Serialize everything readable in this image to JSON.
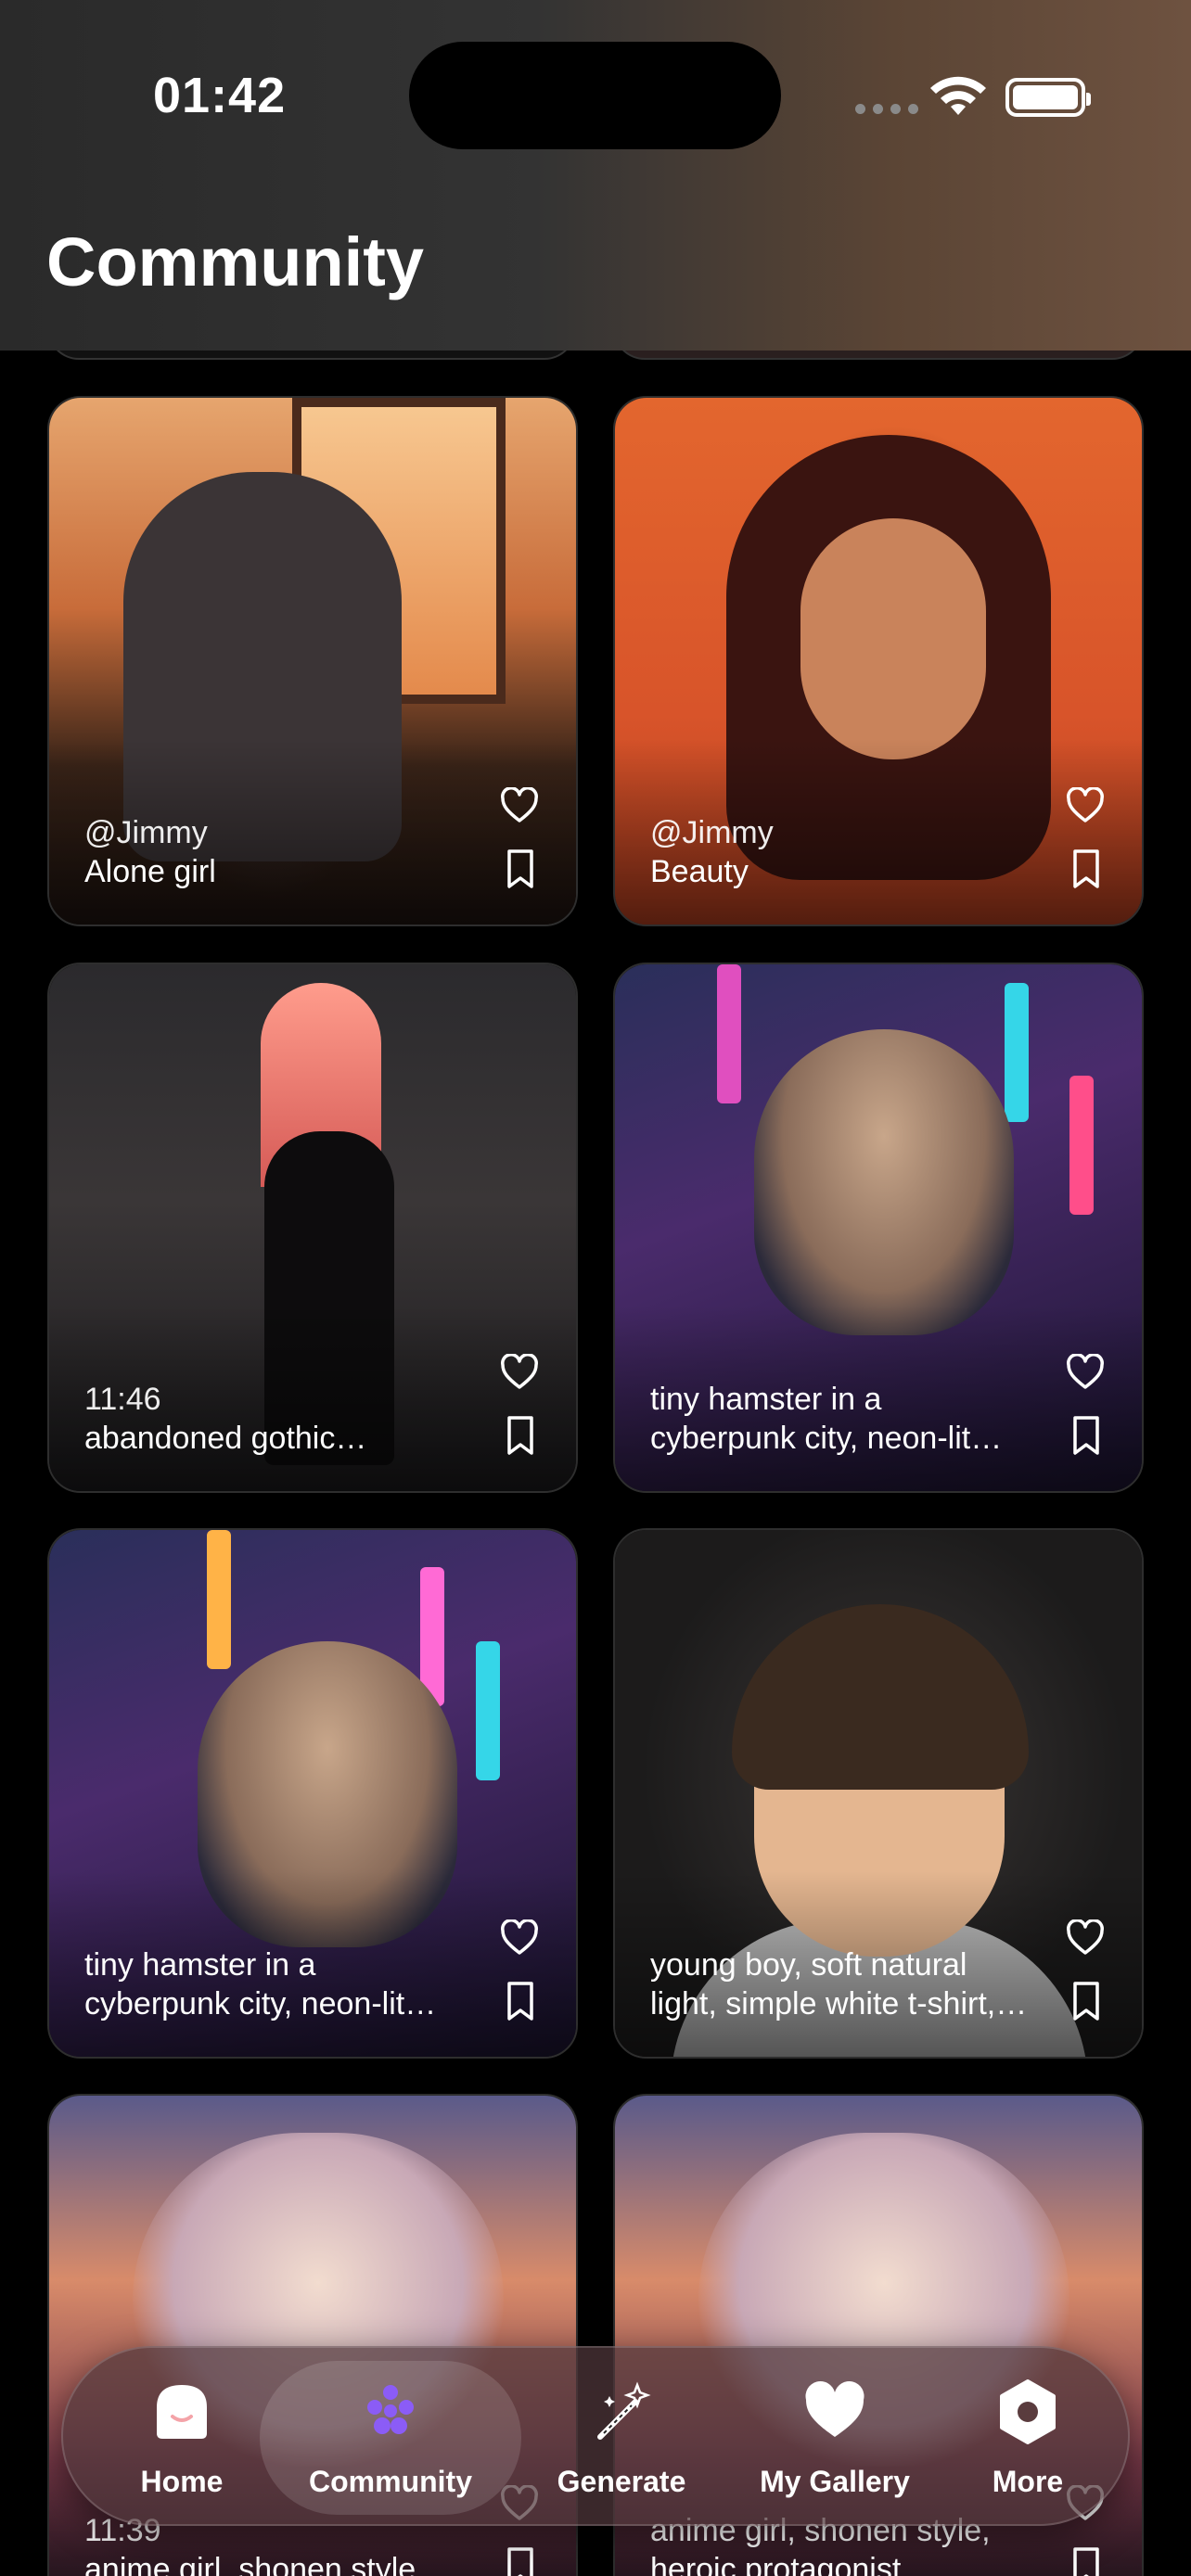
{
  "status_bar": {
    "time": "01:42"
  },
  "header": {
    "title": "Community"
  },
  "cards": [
    {
      "author": "@Jimmy",
      "caption": "Alone girl"
    },
    {
      "author": "@Jimmy",
      "caption": "Beauty"
    },
    {
      "author": "11:46",
      "caption": "abandoned gothic cathedral"
    },
    {
      "author": "",
      "caption": "tiny hamster in a cyberpunk city, neon-lit streets"
    },
    {
      "author": "",
      "caption": "tiny hamster in a cyberpunk city, neon-lit streets"
    },
    {
      "author": "",
      "caption": "young boy, soft natural light, simple white t-shirt, portrait"
    },
    {
      "author": "11:39",
      "caption": "anime girl, shonen style"
    },
    {
      "author": "",
      "caption": "anime girl, shonen style, heroic protagonist, determined"
    }
  ],
  "tabbar": {
    "home": "Home",
    "community": "Community",
    "generate": "Generate",
    "gallery": "My Gallery",
    "more": "More"
  },
  "colors": {
    "accent": "#8b5cf6",
    "background": "#000000"
  },
  "icons": [
    "wifi-icon",
    "battery-icon",
    "heart-icon",
    "bookmark-icon",
    "home-icon",
    "community-icon",
    "generate-icon",
    "gallery-icon",
    "more-icon"
  ]
}
